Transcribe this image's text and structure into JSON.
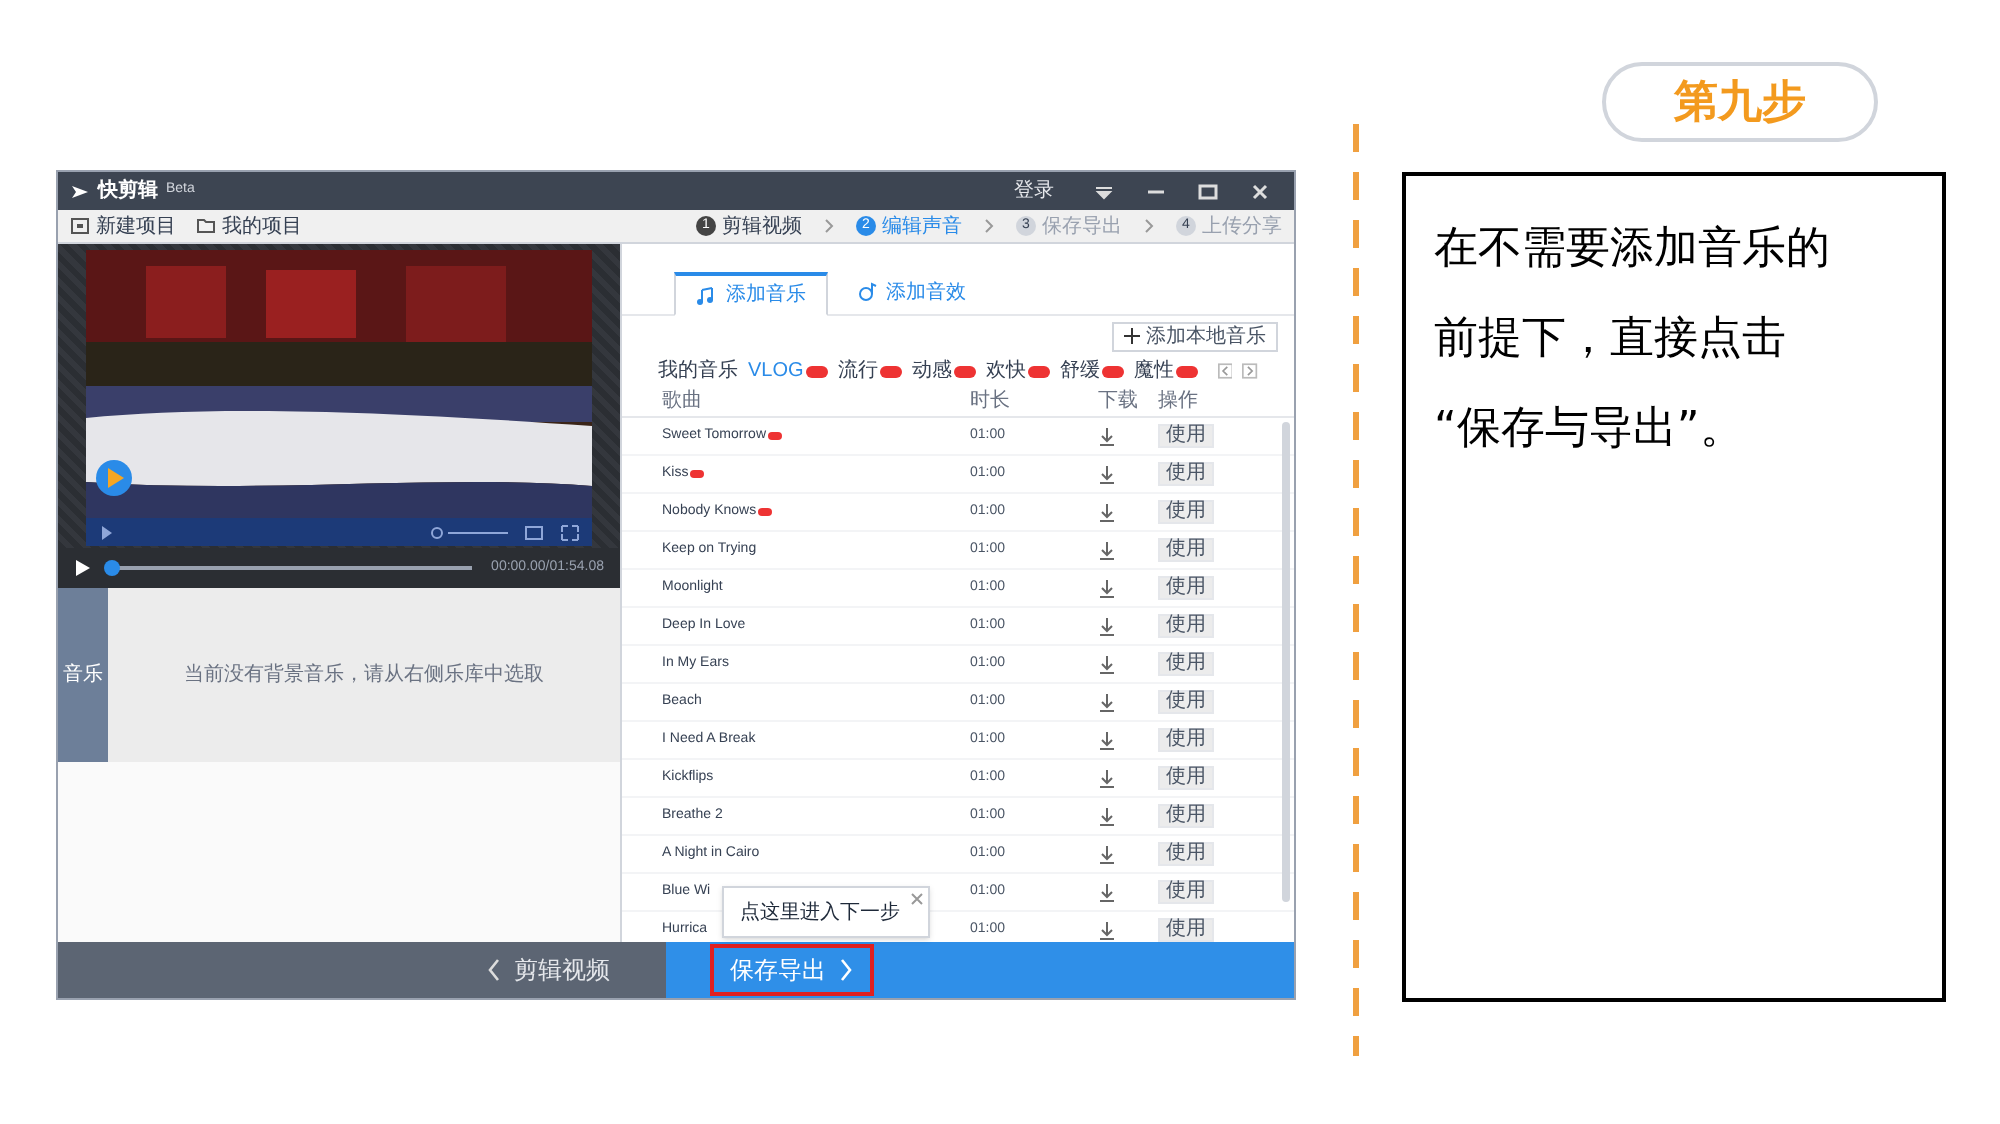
{
  "slide": {
    "step_label": "第九步",
    "instruction": "在不需要添加音乐的前提下，直接点击 “保存与导出”。"
  },
  "app": {
    "title": "快剪辑",
    "edition": "Beta",
    "login": "登录",
    "toolbar": [
      "新建项目",
      "我的项目"
    ],
    "steps": [
      {
        "number": "1",
        "label": "剪辑视频",
        "selected": false,
        "completed": true
      },
      {
        "number": "2",
        "label": "编辑声音",
        "selected": true,
        "completed": false
      },
      {
        "number": "3",
        "label": "保存导出",
        "selected": false,
        "completed": false
      },
      {
        "number": "4",
        "label": "上传分享",
        "selected": false,
        "completed": false
      }
    ],
    "player": {
      "time": "00:00.00/01:54.08",
      "level": 0
    },
    "track": {
      "label": "音乐",
      "empty_message": "当前没有背景音乐，请从右侧乐库中选取"
    },
    "tabs": [
      {
        "label": "添加音乐",
        "selected": true
      },
      {
        "label": "添加音效",
        "selected": false
      }
    ],
    "add_local_button": "添加本地音乐",
    "categories": [
      {
        "label": "我的音乐",
        "selected": false,
        "new": false
      },
      {
        "label": "VLOG",
        "selected": true,
        "new": true
      },
      {
        "label": "流行",
        "selected": false,
        "new": true
      },
      {
        "label": "动感",
        "selected": false,
        "new": true
      },
      {
        "label": "欢快",
        "selected": false,
        "new": true
      },
      {
        "label": "舒缓",
        "selected": false,
        "new": true
      },
      {
        "label": "魔性",
        "selected": false,
        "new": true
      }
    ],
    "columns": [
      "歌曲",
      "时长",
      "下载",
      "操作"
    ],
    "songs": [
      {
        "title": "Sweet Tomorrow",
        "duration": "01:00",
        "new": true,
        "action": "使用"
      },
      {
        "title": "Kiss",
        "duration": "01:00",
        "new": true,
        "action": "使用"
      },
      {
        "title": "Nobody Knows",
        "duration": "01:00",
        "new": true,
        "action": "使用"
      },
      {
        "title": "Keep on Trying",
        "duration": "01:00",
        "new": false,
        "action": "使用"
      },
      {
        "title": "Moonlight",
        "duration": "01:00",
        "new": false,
        "action": "使用"
      },
      {
        "title": "Deep In Love",
        "duration": "01:00",
        "new": false,
        "action": "使用"
      },
      {
        "title": "In My Ears",
        "duration": "01:00",
        "new": false,
        "action": "使用"
      },
      {
        "title": "Beach",
        "duration": "01:00",
        "new": false,
        "action": "使用"
      },
      {
        "title": "I Need A Break",
        "duration": "01:00",
        "new": false,
        "action": "使用"
      },
      {
        "title": "Kickflips",
        "duration": "01:00",
        "new": false,
        "action": "使用"
      },
      {
        "title": "Breathe 2",
        "duration": "01:00",
        "new": false,
        "action": "使用"
      },
      {
        "title": "A Night in Cairo",
        "duration": "01:00",
        "new": false,
        "action": "使用"
      },
      {
        "title": "Blue Wi",
        "duration": "01:00",
        "new": false,
        "action": "使用"
      },
      {
        "title": "Hurrica",
        "duration": "01:00",
        "new": false,
        "action": "使用"
      }
    ],
    "tooltip": {
      "text": "点这里进入下一步"
    },
    "footer": {
      "back": "剪辑视频",
      "next": "保存导出",
      "next_highlighted": true
    }
  }
}
